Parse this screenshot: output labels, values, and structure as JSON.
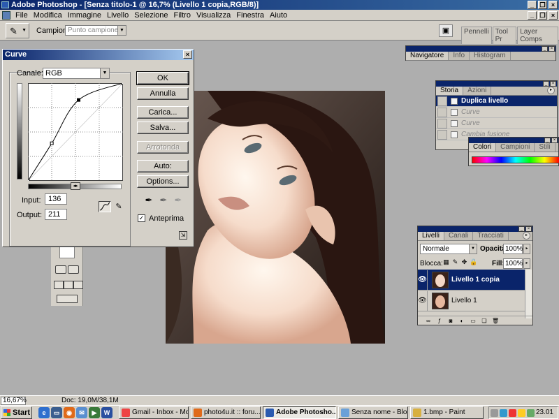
{
  "window": {
    "title": "Adobe Photoshop - [Senza titolo-1 @ 16,7% (Livello 1 copia,RGB/8)]"
  },
  "menubar": {
    "items": [
      "File",
      "Modifica",
      "Immagine",
      "Livello",
      "Selezione",
      "Filtro",
      "Visualizza",
      "Finestra",
      "Aiuto"
    ]
  },
  "options": {
    "campione_label": "Campione:",
    "campione_value": "Punto campione",
    "palette_well_tabs": [
      "Pennelli",
      "Tool Pr",
      "Layer Comps"
    ]
  },
  "curves": {
    "title": "Curve",
    "canale_label": "Canale:",
    "canale_value": "RGB",
    "input_label": "Input:",
    "input_value": "136",
    "output_label": "Output:",
    "output_value": "211",
    "buttons": {
      "ok": "OK",
      "annulla": "Annulla",
      "carica": "Carica...",
      "salva": "Salva...",
      "arrotonda": "Arrotonda",
      "auto": "Auto:",
      "options": "Options..."
    },
    "anteprima_label": "Anteprima",
    "anteprima_checked": true,
    "curve_points": [
      [
        0,
        0
      ],
      [
        64,
        98
      ],
      [
        136,
        211
      ],
      [
        255,
        255
      ]
    ]
  },
  "navigator": {
    "tabs": [
      "Navigatore",
      "Info",
      "Histogram"
    ]
  },
  "history": {
    "tabs": [
      "Storia",
      "Azioni"
    ],
    "items": [
      {
        "label": "Duplica livello",
        "state": "selected"
      },
      {
        "label": "Curve",
        "state": "dim"
      },
      {
        "label": "Curve",
        "state": "dim"
      },
      {
        "label": "Cambia fusione",
        "state": "dim"
      }
    ]
  },
  "colori": {
    "tabs": [
      "Colori",
      "Campioni",
      "Stili"
    ]
  },
  "layers": {
    "tabs": [
      "Livelli",
      "Canali",
      "Tracciati"
    ],
    "blend_mode": "Normale",
    "opacity_label": "Opacità:",
    "opacity_value": "100%",
    "lock_label": "Blocca:",
    "fill_label": "Fill:",
    "fill_value": "100%",
    "items": [
      {
        "name": "Livello 1 copia",
        "selected": true
      },
      {
        "name": "Livello 1",
        "selected": false
      }
    ]
  },
  "status": {
    "zoom": "16,67%",
    "doc": "Doc: 19,0M/38,1M"
  },
  "taskbar": {
    "start_label": "Start",
    "tasks": [
      "Gmail - Inbox - Mo...",
      "photo4u.it :: foru...",
      "Adobe Photosho...",
      "Senza nome - Bloc...",
      "1.bmp - Paint"
    ],
    "active_task": "Adobe Photosho...",
    "clock": "23.01"
  },
  "colors": {
    "titlebar": "#0a246a",
    "chrome": "#d4d0c8",
    "workspace": "#aeaeae",
    "selection": "#0a246a"
  }
}
